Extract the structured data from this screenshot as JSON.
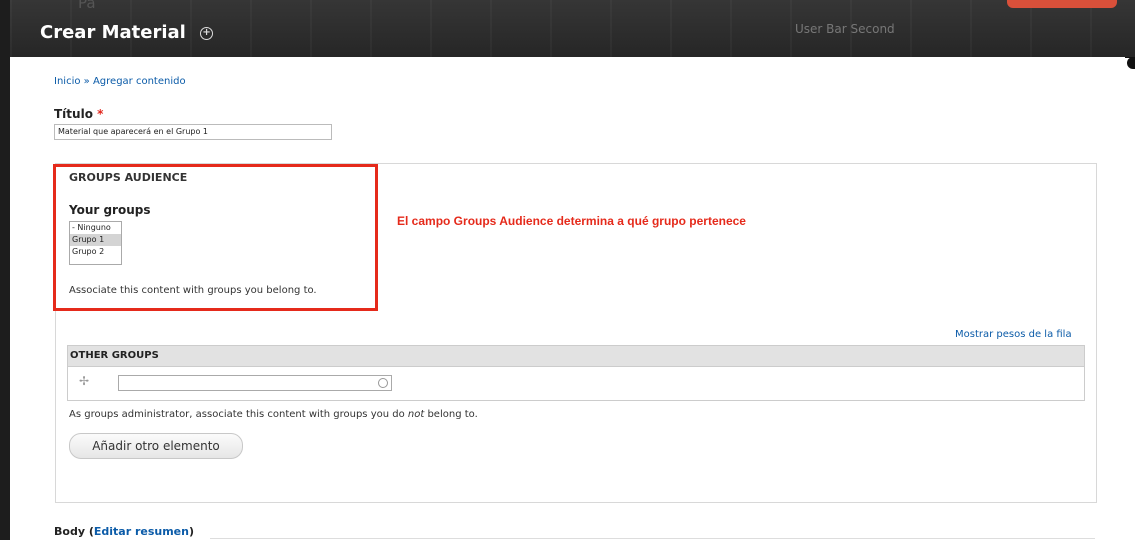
{
  "header": {
    "title": "Crear Material",
    "ghost_text": "Pa",
    "user_bar": "User Bar Second"
  },
  "breadcrumb": {
    "home": "Inicio",
    "separator": "»",
    "current": "Agregar contenido"
  },
  "title_field": {
    "label": "Título",
    "required_mark": "*",
    "value": "Material que aparecerá en el Grupo 1"
  },
  "groups_audience": {
    "heading": "GROUPS AUDIENCE",
    "your_groups_label": "Your groups",
    "options": [
      "- Ninguno",
      "Grupo 1",
      "Grupo 2"
    ],
    "selected": "Grupo 1",
    "description": "Associate this content with groups you belong to."
  },
  "annotation": "El campo Groups Audience determina a qué grupo pertenece",
  "row_weights_link": "Mostrar pesos de la fila",
  "other_groups": {
    "heading": "OTHER GROUPS",
    "value": "",
    "description_before": "As groups administrator, associate this content with groups you do ",
    "description_em": "not",
    "description_after": " belong to.",
    "add_button": "Añadir otro elemento"
  },
  "body_field": {
    "label": "Body",
    "link": "Editar resumen"
  },
  "colors": {
    "annotation_red": "#e52a1b",
    "link_blue": "#0b5ba8",
    "header_dark": "#2a2a2a"
  }
}
